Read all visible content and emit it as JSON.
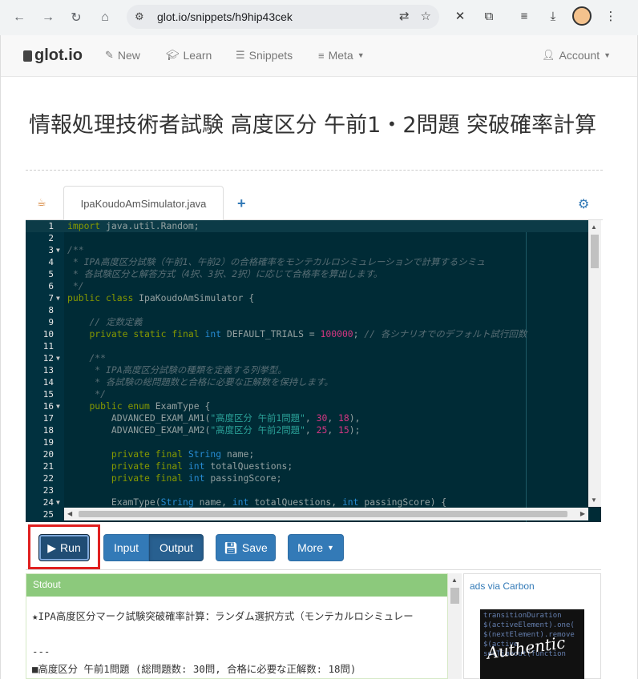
{
  "browser": {
    "url": "glot.io/snippets/h9hip43cek"
  },
  "navbar": {
    "brand": "glot.io",
    "items": [
      {
        "label": "New"
      },
      {
        "label": "Learn"
      },
      {
        "label": "Snippets"
      },
      {
        "label": "Meta"
      }
    ],
    "account": "Account"
  },
  "title": "情報処理技術者試験 高度区分 午前1・2問題 突破確率計算",
  "tabs": {
    "file_name": "IpaKoudoAmSimulator.java"
  },
  "editor": {
    "lines": [
      {
        "n": "1",
        "code": "import java.util.Random;"
      },
      {
        "n": "2",
        "code": ""
      },
      {
        "n": "3",
        "code": "/**"
      },
      {
        "n": "4",
        "code": " * IPA高度区分試験（午前1、午前2）の合格確率をモンテカルロシミュレーションで計算するシミュ"
      },
      {
        "n": "5",
        "code": " * 各試験区分と解答方式（4択、3択、2択）に応じて合格率を算出します。"
      },
      {
        "n": "6",
        "code": " */"
      },
      {
        "n": "7",
        "code": "public class IpaKoudoAmSimulator {"
      },
      {
        "n": "8",
        "code": ""
      },
      {
        "n": "9",
        "code": "    // 定数定義"
      },
      {
        "n": "10",
        "code": "    private static final int DEFAULT_TRIALS = 100000; // 各シナリオでのデフォルト試行回数"
      },
      {
        "n": "11",
        "code": ""
      },
      {
        "n": "12",
        "code": "    /**"
      },
      {
        "n": "13",
        "code": "     * IPA高度区分試験の種類を定義する列挙型。"
      },
      {
        "n": "14",
        "code": "     * 各試験の総問題数と合格に必要な正解数を保持します。"
      },
      {
        "n": "15",
        "code": "     */"
      },
      {
        "n": "16",
        "code": "    public enum ExamType {"
      },
      {
        "n": "17",
        "code": "        ADVANCED_EXAM_AM1(\"高度区分 午前1問題\", 30, 18),"
      },
      {
        "n": "18",
        "code": "        ADVANCED_EXAM_AM2(\"高度区分 午前2問題\", 25, 15);"
      },
      {
        "n": "19",
        "code": ""
      },
      {
        "n": "20",
        "code": "        private final String name;"
      },
      {
        "n": "21",
        "code": "        private final int totalQuestions;"
      },
      {
        "n": "22",
        "code": "        private final int passingScore;"
      },
      {
        "n": "23",
        "code": ""
      },
      {
        "n": "24",
        "code": "        ExamType(String name, int totalQuestions, int passingScore) {"
      },
      {
        "n": "25",
        "code": ""
      }
    ]
  },
  "toolbar": {
    "run": "Run",
    "input": "Input",
    "output": "Output",
    "save": "Save",
    "more": "More"
  },
  "output": {
    "header": "Stdout",
    "text": "★IPA高度区分マーク試験突破確率計算：ランダム選択方式（モンテカルロシミュレー\n\n---\n■高度区分 午前1問題 (総問題数: 30問, 合格に必要な正解数: 18問)\n---"
  },
  "ads": {
    "header": "ads via Carbon"
  }
}
